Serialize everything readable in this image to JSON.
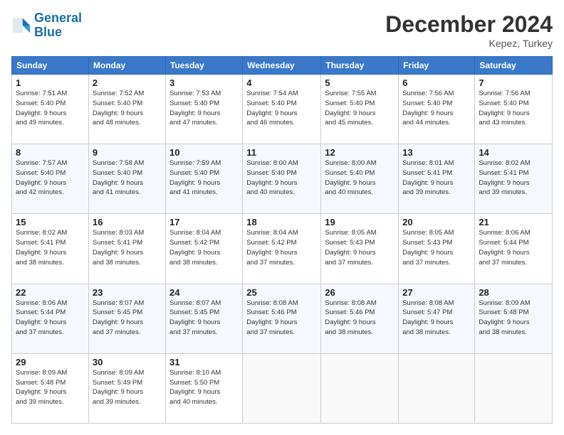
{
  "header": {
    "logo_line1": "General",
    "logo_line2": "Blue",
    "month_title": "December 2024",
    "location": "Kepez, Turkey"
  },
  "weekdays": [
    "Sunday",
    "Monday",
    "Tuesday",
    "Wednesday",
    "Thursday",
    "Friday",
    "Saturday"
  ],
  "weeks": [
    [
      {
        "day": "1",
        "info": "Sunrise: 7:51 AM\nSunset: 5:40 PM\nDaylight: 9 hours\nand 49 minutes."
      },
      {
        "day": "2",
        "info": "Sunrise: 7:52 AM\nSunset: 5:40 PM\nDaylight: 9 hours\nand 48 minutes."
      },
      {
        "day": "3",
        "info": "Sunrise: 7:53 AM\nSunset: 5:40 PM\nDaylight: 9 hours\nand 47 minutes."
      },
      {
        "day": "4",
        "info": "Sunrise: 7:54 AM\nSunset: 5:40 PM\nDaylight: 9 hours\nand 46 minutes."
      },
      {
        "day": "5",
        "info": "Sunrise: 7:55 AM\nSunset: 5:40 PM\nDaylight: 9 hours\nand 45 minutes."
      },
      {
        "day": "6",
        "info": "Sunrise: 7:56 AM\nSunset: 5:40 PM\nDaylight: 9 hours\nand 44 minutes."
      },
      {
        "day": "7",
        "info": "Sunrise: 7:56 AM\nSunset: 5:40 PM\nDaylight: 9 hours\nand 43 minutes."
      }
    ],
    [
      {
        "day": "8",
        "info": "Sunrise: 7:57 AM\nSunset: 5:40 PM\nDaylight: 9 hours\nand 42 minutes."
      },
      {
        "day": "9",
        "info": "Sunrise: 7:58 AM\nSunset: 5:40 PM\nDaylight: 9 hours\nand 41 minutes."
      },
      {
        "day": "10",
        "info": "Sunrise: 7:59 AM\nSunset: 5:40 PM\nDaylight: 9 hours\nand 41 minutes."
      },
      {
        "day": "11",
        "info": "Sunrise: 8:00 AM\nSunset: 5:40 PM\nDaylight: 9 hours\nand 40 minutes."
      },
      {
        "day": "12",
        "info": "Sunrise: 8:00 AM\nSunset: 5:40 PM\nDaylight: 9 hours\nand 40 minutes."
      },
      {
        "day": "13",
        "info": "Sunrise: 8:01 AM\nSunset: 5:41 PM\nDaylight: 9 hours\nand 39 minutes."
      },
      {
        "day": "14",
        "info": "Sunrise: 8:02 AM\nSunset: 5:41 PM\nDaylight: 9 hours\nand 39 minutes."
      }
    ],
    [
      {
        "day": "15",
        "info": "Sunrise: 8:02 AM\nSunset: 5:41 PM\nDaylight: 9 hours\nand 38 minutes."
      },
      {
        "day": "16",
        "info": "Sunrise: 8:03 AM\nSunset: 5:41 PM\nDaylight: 9 hours\nand 38 minutes."
      },
      {
        "day": "17",
        "info": "Sunrise: 8:04 AM\nSunset: 5:42 PM\nDaylight: 9 hours\nand 38 minutes."
      },
      {
        "day": "18",
        "info": "Sunrise: 8:04 AM\nSunset: 5:42 PM\nDaylight: 9 hours\nand 37 minutes."
      },
      {
        "day": "19",
        "info": "Sunrise: 8:05 AM\nSunset: 5:43 PM\nDaylight: 9 hours\nand 37 minutes."
      },
      {
        "day": "20",
        "info": "Sunrise: 8:05 AM\nSunset: 5:43 PM\nDaylight: 9 hours\nand 37 minutes."
      },
      {
        "day": "21",
        "info": "Sunrise: 8:06 AM\nSunset: 5:44 PM\nDaylight: 9 hours\nand 37 minutes."
      }
    ],
    [
      {
        "day": "22",
        "info": "Sunrise: 8:06 AM\nSunset: 5:44 PM\nDaylight: 9 hours\nand 37 minutes."
      },
      {
        "day": "23",
        "info": "Sunrise: 8:07 AM\nSunset: 5:45 PM\nDaylight: 9 hours\nand 37 minutes."
      },
      {
        "day": "24",
        "info": "Sunrise: 8:07 AM\nSunset: 5:45 PM\nDaylight: 9 hours\nand 37 minutes."
      },
      {
        "day": "25",
        "info": "Sunrise: 8:08 AM\nSunset: 5:46 PM\nDaylight: 9 hours\nand 37 minutes."
      },
      {
        "day": "26",
        "info": "Sunrise: 8:08 AM\nSunset: 5:46 PM\nDaylight: 9 hours\nand 38 minutes."
      },
      {
        "day": "27",
        "info": "Sunrise: 8:08 AM\nSunset: 5:47 PM\nDaylight: 9 hours\nand 38 minutes."
      },
      {
        "day": "28",
        "info": "Sunrise: 8:09 AM\nSunset: 5:48 PM\nDaylight: 9 hours\nand 38 minutes."
      }
    ],
    [
      {
        "day": "29",
        "info": "Sunrise: 8:09 AM\nSunset: 5:48 PM\nDaylight: 9 hours\nand 39 minutes."
      },
      {
        "day": "30",
        "info": "Sunrise: 8:09 AM\nSunset: 5:49 PM\nDaylight: 9 hours\nand 39 minutes."
      },
      {
        "day": "31",
        "info": "Sunrise: 8:10 AM\nSunset: 5:50 PM\nDaylight: 9 hours\nand 40 minutes."
      },
      {
        "day": "",
        "info": ""
      },
      {
        "day": "",
        "info": ""
      },
      {
        "day": "",
        "info": ""
      },
      {
        "day": "",
        "info": ""
      }
    ]
  ]
}
